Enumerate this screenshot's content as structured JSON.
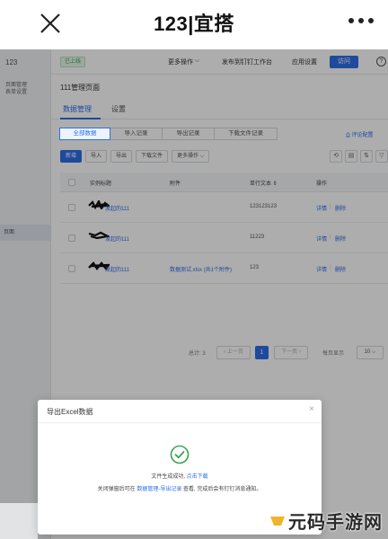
{
  "phone": {
    "title": "123|宜搭"
  },
  "sidebar": {
    "app": "123",
    "items": [
      "页面管理",
      "表单设置"
    ],
    "active": "页面"
  },
  "topbar": {
    "status": "已上线",
    "more": "更多操作",
    "publish": "发布到钉钉工作台",
    "settings": "应用设置",
    "visit": "访问",
    "help": "?"
  },
  "page": {
    "name": "111管理页面",
    "tabs": [
      "数据管理",
      "设置"
    ],
    "segments": [
      "全部数据",
      "导入记录",
      "导出记录",
      "下载文件记录"
    ],
    "print": "⎙ 评论配置",
    "actions": [
      "新增",
      "导入",
      "导出",
      "下载文件",
      "更多操作 ⌵"
    ],
    "tools": [
      "⟲",
      "▤",
      "⇅",
      "▽"
    ]
  },
  "table": {
    "headers": [
      "实例标题",
      "附件",
      "单行文本 ⇕",
      "操作"
    ],
    "rows": [
      {
        "title": "发起的111",
        "attachment": "",
        "text": "123123123",
        "op1": "详情",
        "op2": "删除"
      },
      {
        "title": "发起的111",
        "attachment": "",
        "text": "11223",
        "op1": "详情",
        "op2": "删除"
      },
      {
        "title": "发起的111",
        "attachment": "数据测试.xlsx (共1个附件)",
        "text": "123",
        "op1": "详情",
        "op2": "删除"
      }
    ]
  },
  "pager": {
    "total": "总计: 3",
    "prev": "‹ 上一页",
    "current": "1",
    "next": "下一页 ›",
    "per_page_label": "每页显示",
    "per_page": "10 ⌵"
  },
  "modal": {
    "title": "导出Excel数据",
    "close": "×",
    "line1_pre": "文件生成成功,",
    "line1_link": "点击下载",
    "line2_pre": "关闭弹窗后可在",
    "line2_link": "数据管理-导出记录",
    "line2_post": "查看, 完成后会有钉钉消息通知。"
  },
  "watermark": {
    "text": "元码手游网"
  },
  "colors": {
    "primary": "#2b6ee8",
    "success": "#3aa455"
  }
}
